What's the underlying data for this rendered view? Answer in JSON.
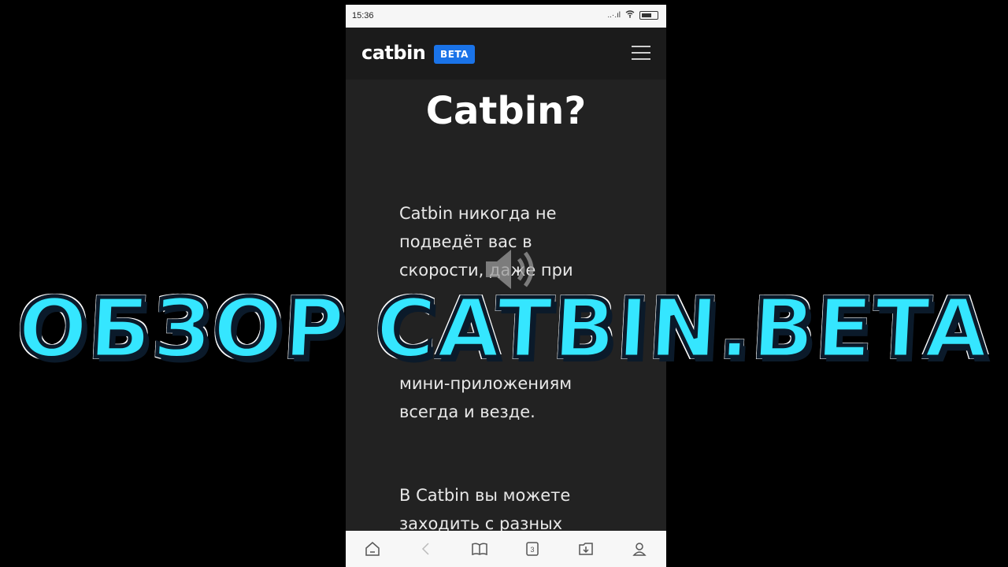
{
  "status_bar": {
    "time": "15:36",
    "signal_text": "..·.ıl"
  },
  "app_bar": {
    "logo": "catbin",
    "badge": "BETA"
  },
  "main": {
    "title": "Catbin?",
    "paragraph1": "Catbin никогда не подведёт вас в скорости, даже при",
    "paragraph1_tail": "мини-приложениям всегда и везде.",
    "paragraph2": "В Catbin вы можете заходить с разных"
  },
  "bottom_nav": {
    "items": [
      "home-icon",
      "back-icon",
      "bookmarks-icon",
      "tabs-icon",
      "downloads-icon",
      "profile-icon"
    ],
    "tab_count": "3"
  },
  "overlay": {
    "title": "ОБЗОР CATBIN.BETA"
  },
  "colors": {
    "accent": "#1a73e8",
    "overlay_text": "#35e6ff",
    "app_bg": "#222222"
  }
}
